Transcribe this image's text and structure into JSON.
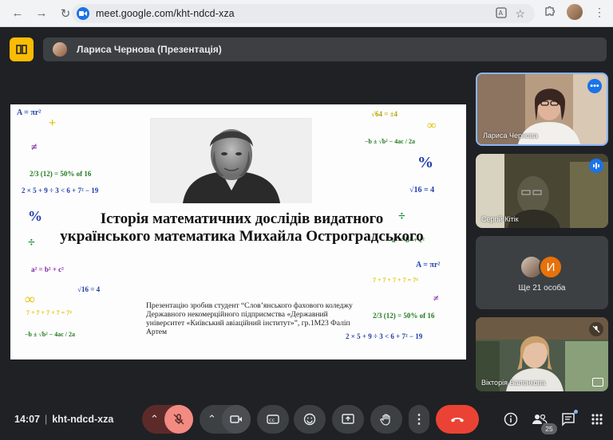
{
  "browser": {
    "url": "meet.google.com/kht-ndcd-xza"
  },
  "meeting": {
    "presenter_label": "Лариса Чернова (Презентація)",
    "time": "14:07",
    "code": "kht-ndcd-xza",
    "participant_count": "25"
  },
  "slide": {
    "title": "Історія математичних дослідів видатного українського математика Михайла Остроградського",
    "credit": "Презентацію зробив студент  “Слов’янського фахового коледжу Державного некомерційного підприємства «Державний університет «Київський авіаційний інститут»”, гр.1М23 Фаліп Артем",
    "formulas": [
      "A = πr²",
      "+",
      "≠",
      "2/3 (12) = 50% of 16",
      "2 × 5 + 9 ÷ 3 < 6 + 7² − 19",
      "%",
      "÷",
      "a² = b² + c²",
      "∞",
      "√16 = 4",
      "7 + 7 + 7 + 7 = 7⁴",
      "−b ± √b² − 4ac / 2a",
      "√64 = ±4",
      "∞",
      "−b ± √b² − 4ac / 2a",
      "%",
      "√16 = 4",
      "÷",
      "a² = b² + c²",
      "A = πr²",
      "7 + 7 + 7 + 7 = 7⁴",
      "≠",
      "2/3 (12) = 50% of 16",
      "2 × 5 + 9 ÷ 3 < 6 + 7² − 19"
    ]
  },
  "participants": [
    {
      "name": "Лариса Чернова"
    },
    {
      "name": "Сергій Кітік"
    },
    {
      "name": "Ще 21 особа",
      "initial": "И"
    },
    {
      "name": "Вікторія Баленкова"
    }
  ],
  "icons": {
    "back": "arrow-left-icon",
    "forward": "arrow-right-icon",
    "reload": "reload-icon",
    "translate": "translate-icon",
    "bookmark": "star-icon",
    "extensions": "puzzle-icon",
    "mic": "mic-off-icon",
    "camera": "camera-icon",
    "captions": "captions-icon",
    "emoji": "emoji-icon",
    "present": "present-icon",
    "hand": "hand-icon",
    "more": "more-vert-icon",
    "end_call": "end-call-icon",
    "info": "info-icon",
    "people": "people-icon",
    "chat": "chat-icon",
    "activities": "grid-icon"
  },
  "colors": {
    "end_call": "#ea4335",
    "meet_yellow": "#fbbc04",
    "mic_muted": "#f28b82",
    "accent": "#8ab4f8"
  }
}
